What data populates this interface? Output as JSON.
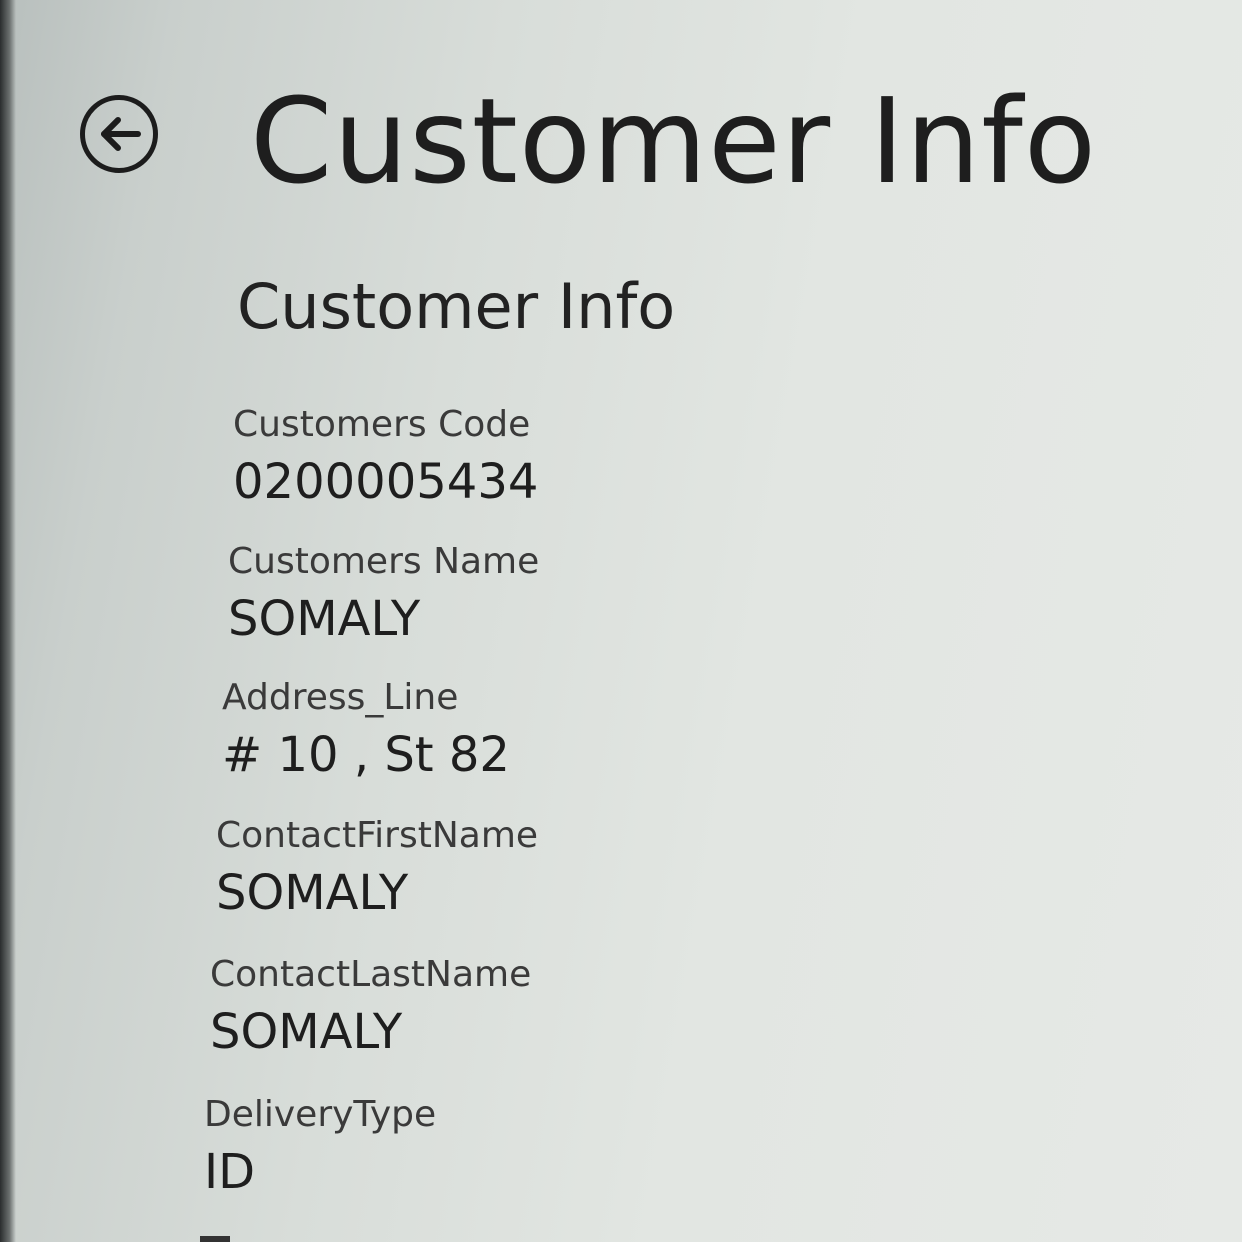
{
  "header": {
    "back_icon": "back-arrow-circle-icon",
    "title": "Customer Info"
  },
  "section": {
    "title": "Customer Info"
  },
  "fields": [
    {
      "label": "Customers Code",
      "value": "0200005434"
    },
    {
      "label": "Customers Name",
      "value": "SOMALY"
    },
    {
      "label": "Address_Line",
      "value": "# 10 , St 82"
    },
    {
      "label": "ContactFirstName",
      "value": "SOMALY"
    },
    {
      "label": "ContactLastName",
      "value": "SOMALY"
    },
    {
      "label": "DeliveryType",
      "value": "ID"
    }
  ]
}
